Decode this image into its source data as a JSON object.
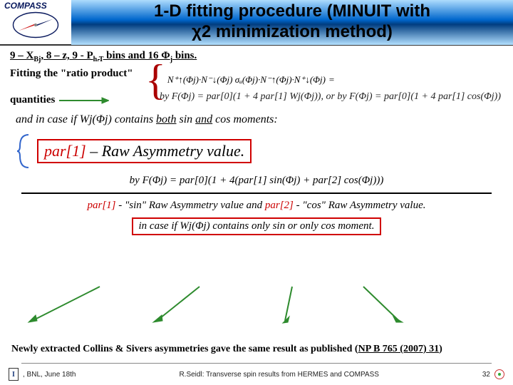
{
  "header": {
    "logo_text": "COMPASS",
    "title_line1": "1-D fitting procedure (MINUIT with",
    "title_line2": "χ2 minimization method)"
  },
  "bins_text": {
    "prefix": "9 – X",
    "sub1": "Bj",
    "mid1": ", 8 – z, 9 - P",
    "sub2": "h.T",
    "mid2": " bins and 16 Φ",
    "sub3": "j",
    "suffix": " bins."
  },
  "labels": {
    "fitting": "Fitting the \"ratio product\"",
    "quantities": "quantities"
  },
  "formula_ratio": {
    "lhs_num": "N⁺↑(Φj)·N⁻↓(Φj)",
    "lhs_den": "σₐ(Φj)·N⁻↑(Φj)·N⁺↓(Φj)",
    "eq": "=",
    "rhs": "by F(Φj) = par[0](1 + 4 par[1] Wj(Φj)), or by F(Φj) = par[0](1 + 4 par[1] cos(Φj))"
  },
  "case_both": {
    "prefix": "and in case if Wj(Φj) contains ",
    "both": "both",
    "mid": " sin ",
    "and": "and",
    "suffix": " cos moments:"
  },
  "raw_box": {
    "par": "par[1]",
    "dash": "  –  ",
    "text": "Raw Asymmetry value."
  },
  "formula_center": "by F(Φj) = par[0](1 + 4(par[1] sin(Φj) + par[2] cos(Φj)))",
  "sincos_line": {
    "p1": "par[1]",
    "t1": " - \"sin\" Raw Asymmetry value and ",
    "p2": "par[2]",
    "t2": " - \"cos\" Raw Asymmetry value."
  },
  "case_only": {
    "prefix": "in case if Wj(Φj) contains only sin or only cos moment."
  },
  "newly": {
    "text": "Newly extracted Collins & Sivers asymmetries gave the same result as published (",
    "link": "NP B 765 (2007) 31",
    "suffix": ")"
  },
  "footer": {
    "left": ", BNL, June 18th",
    "center": "R.Seidl: Transverse spin results from HERMES and COMPASS",
    "right": "32"
  }
}
